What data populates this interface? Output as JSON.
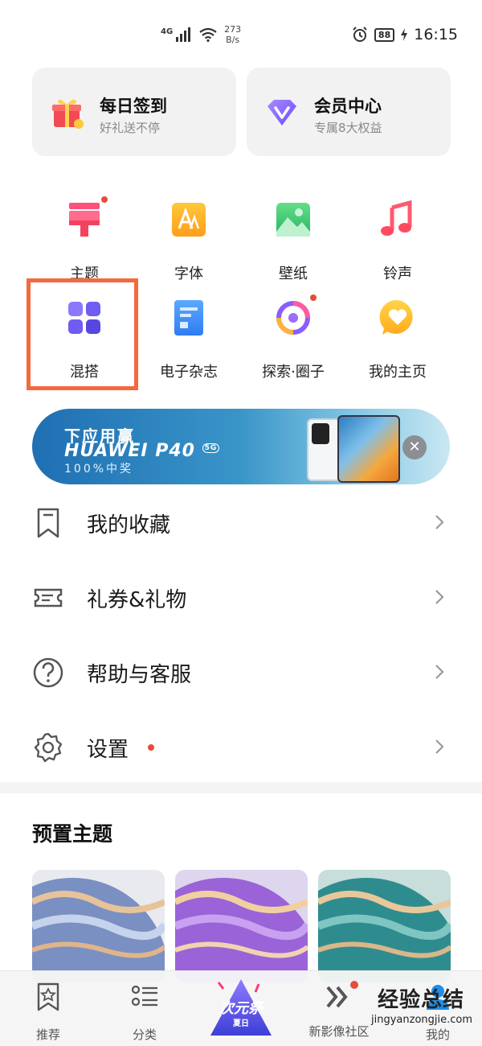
{
  "status_bar": {
    "network": "4G",
    "speed_value": "273",
    "speed_unit": "B/s",
    "battery": "88",
    "time": "16:15"
  },
  "cards": {
    "daily_sign": {
      "title": "每日签到",
      "subtitle": "好礼送不停"
    },
    "vip_center": {
      "title": "会员中心",
      "subtitle": "专属8大权益"
    }
  },
  "grid": [
    {
      "label": "主题",
      "icon": "paint-brush-icon",
      "badge": true
    },
    {
      "label": "字体",
      "icon": "font-icon",
      "badge": false
    },
    {
      "label": "壁纸",
      "icon": "wallpaper-icon",
      "badge": false
    },
    {
      "label": "铃声",
      "icon": "music-note-icon",
      "badge": false
    },
    {
      "label": "混搭",
      "icon": "mix-grid-icon",
      "badge": false,
      "highlighted": true
    },
    {
      "label": "电子杂志",
      "icon": "magazine-icon",
      "badge": false
    },
    {
      "label": "探索·圈子",
      "icon": "explore-ring-icon",
      "badge": true
    },
    {
      "label": "我的主页",
      "icon": "heart-bubble-icon",
      "badge": false
    }
  ],
  "banner": {
    "line1": "下应用赢",
    "line2": "HUAWEI P40",
    "line2_badge": "5G",
    "line3": "100%中奖",
    "close_label": "✕"
  },
  "menu": [
    {
      "label": "我的收藏",
      "icon": "bookmark-icon",
      "badge": false
    },
    {
      "label": "礼券&礼物",
      "icon": "ticket-icon",
      "badge": false
    },
    {
      "label": "帮助与客服",
      "icon": "help-icon",
      "badge": false
    },
    {
      "label": "设置",
      "icon": "gear-icon",
      "badge": true
    }
  ],
  "preset_section": {
    "title": "预置主题"
  },
  "bottom_nav": [
    {
      "label": "推荐",
      "icon": "star-bookmark-icon"
    },
    {
      "label": "分类",
      "icon": "category-list-icon"
    },
    {
      "label": "",
      "icon": "festival-logo-icon",
      "logo_text": "次元祭",
      "logo_sub": "夏日"
    },
    {
      "label": "新影像社区",
      "icon": "double-chevron-icon",
      "badge": true
    },
    {
      "label": "我的",
      "icon": "profile-icon"
    }
  ],
  "watermark": {
    "text": "经验总结",
    "url": "jingyanzongjie.com"
  },
  "colors": {
    "accent_red": "#e84b3a",
    "highlight_box": "#f26a3c",
    "card_bg": "#f2f2f2"
  }
}
